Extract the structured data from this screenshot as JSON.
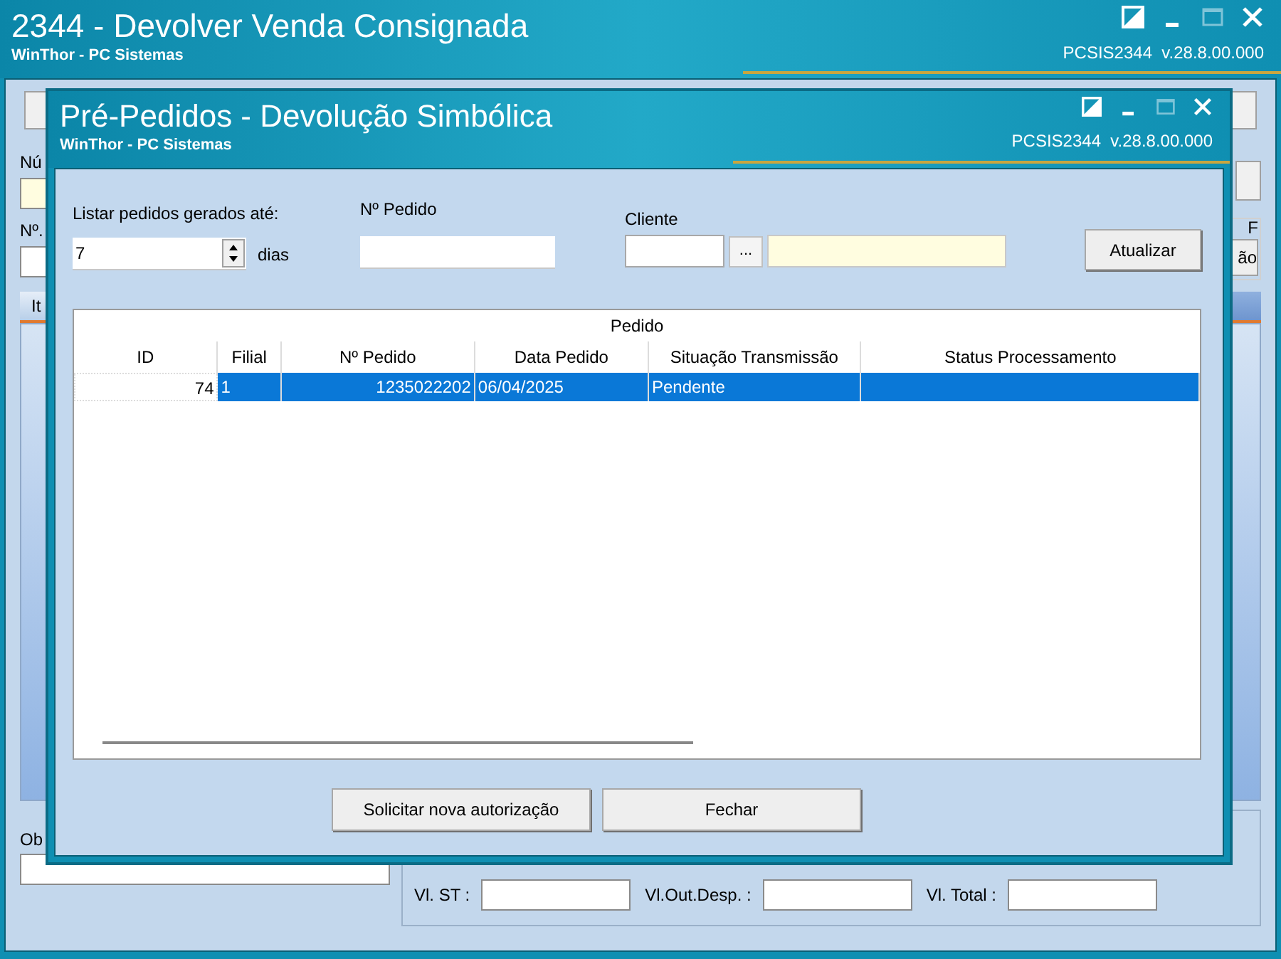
{
  "window": {
    "title": "2344 - Devolver Venda Consignada",
    "subtitle": "WinThor - PC Sistemas",
    "version": "PCSIS2344  v.28.8.00.000"
  },
  "main_form": {
    "number_label": "Nú",
    "order_label": "Nº.",
    "tab": "It",
    "group_label": "F",
    "side_button": "ão",
    "obs_label": "Ob",
    "totals": [
      {
        "label": "Vl. ST :"
      },
      {
        "label": "Vl.Out.Desp. :"
      },
      {
        "label": "Vl. Total :"
      }
    ]
  },
  "dialog": {
    "title": "Pré-Pedidos - Devolução Simbólica",
    "subtitle": "WinThor - PC Sistemas",
    "version": "PCSIS2344  v.28.8.00.000",
    "filters": {
      "days_label": "Listar pedidos gerados até:",
      "days_value": "7",
      "days_unit": "dias",
      "order_label": "Nº Pedido",
      "client_label": "Cliente",
      "lookup_button": "...",
      "refresh_button": "Atualizar"
    },
    "table": {
      "group_header": "Pedido",
      "columns": [
        "ID",
        "Filial",
        "Nº Pedido",
        "Data Pedido",
        "Situação Transmissão",
        "Status Processamento"
      ],
      "rows": [
        {
          "selected": true,
          "cells": [
            "74",
            "1",
            "1235022202",
            "06/04/2025",
            "Pendente"
          ]
        }
      ]
    },
    "buttons": [
      "Solicitar nova autorização",
      "Fechar"
    ]
  }
}
